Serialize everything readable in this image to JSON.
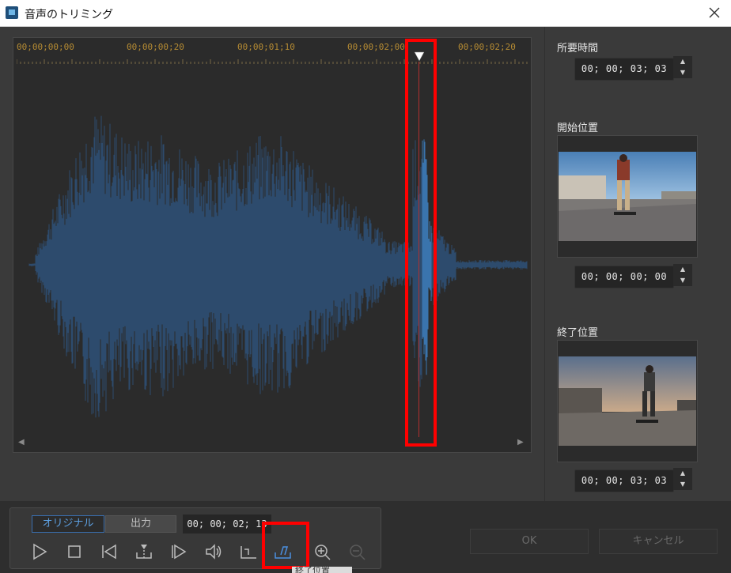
{
  "window": {
    "title": "音声のトリミング",
    "close_icon": "close-icon"
  },
  "ruler": {
    "timecodes": [
      "00;00;00;00",
      "00;00;00;20",
      "00;00;01;10",
      "00;00;02;00",
      "00;00;02;20"
    ]
  },
  "side": {
    "duration_label": "所要時間",
    "duration_value": "00; 00; 03; 03",
    "start_label": "開始位置",
    "start_value": "00; 00; 00; 00",
    "end_label": "終了位置",
    "end_value": "00; 00; 03; 03"
  },
  "controls": {
    "tab_original": "オリジナル",
    "tab_output": "出力",
    "current_time": "00; 00; 02; 13",
    "tooltip": "終了位置"
  },
  "buttons": {
    "ok": "OK",
    "cancel": "キャンセル"
  },
  "colors": {
    "waveform": "#2d4b6d",
    "waveform_highlight": "#3a74ad",
    "accent": "#3a86e0",
    "highlight_box": "#ff0000",
    "ruler_text": "#b58b33"
  }
}
